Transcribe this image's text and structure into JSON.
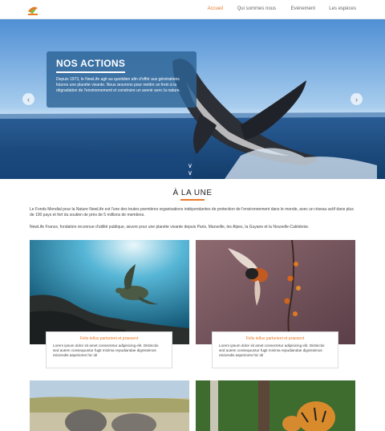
{
  "header": {
    "nav": [
      {
        "label": "Accueil",
        "active": true
      },
      {
        "label": "Qui sommes nous",
        "active": false
      },
      {
        "label": "Evénement",
        "active": false
      },
      {
        "label": "Les espèces",
        "active": false
      }
    ]
  },
  "hero": {
    "title": "NOS ACTIONS",
    "text": "Depuis 1973, le NewLife agit au quotidien afin d'offrir aux générations futures une planète vivante. Nous œuvrons pour mettre un frein à la dégradation de l'environnement et construire un avenir avec la nature.",
    "prev_icon": "chevron-left-icon",
    "next_icon": "chevron-right-icon",
    "scroll_icon": "double-chevron-down-icon"
  },
  "section": {
    "title": "À LA UNE",
    "intro1": "Le Fonds Mondial pour la Nature NewLife est l'une des toutes premières organisations indépendantes de protection de l'environnement dans le monde, avec un réseau actif dans plus de 100 pays et fort du soutien de près de 5 millions de membres.",
    "intro2": "NewLife France, fondation reconnue d'utilité publique, œuvre pour une planète vivante depuis Paris, Marseille, les Alpes, la Guyane et la Nouvelle-Calédonie."
  },
  "cards": [
    {
      "title": "Felis tellus parturient et praesent",
      "text": "Lorem ipsum dolor sit amet consectetur adipisicing elit. Distinctio sed autem consequuntur fugit minima repudiandae dignissimos reiciendis asperiores hic id!"
    },
    {
      "title": "Felis tellus parturient et praesent",
      "text": "Lorem ipsum dolor sit amet consectetur adipisicing elit. Distinctio sed autem consequuntur fugit minima repudiandae dignissimos reiciendis asperiores hic id!"
    }
  ],
  "colors": {
    "accent": "#e87a2a",
    "panel": "#2d6496"
  }
}
